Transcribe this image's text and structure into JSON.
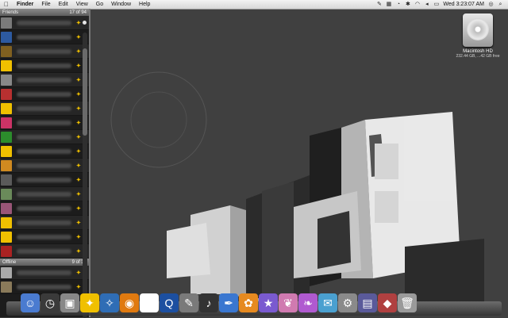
{
  "menubar": {
    "apple": "",
    "menus": [
      "Finder",
      "File",
      "Edit",
      "View",
      "Go",
      "Window",
      "Help"
    ],
    "clock": "Wed 3:23:07 AM",
    "icons": [
      "battery-icon",
      "volume-icon",
      "wifi-icon",
      "bluetooth-icon",
      "spotlight-icon"
    ]
  },
  "buddy_list": {
    "group1": {
      "name": "Friends",
      "count": "17 of 94"
    },
    "group2": {
      "name": "Offline",
      "count": "9 of 36"
    },
    "buddies1": [
      {
        "color": "#7a7a7a",
        "status": "#e6e6e6"
      },
      {
        "color": "#2d5aa0",
        "status": "#e6e6e6"
      },
      {
        "color": "#806020",
        "status": "#a8d84c"
      },
      {
        "color": "#f0c000",
        "status": "#e6e6e6"
      },
      {
        "color": "#888888",
        "status": "#e6e6e6"
      },
      {
        "color": "#b83030",
        "status": "#e6e6e6"
      },
      {
        "color": "#f0c000",
        "status": "#e6e6e6"
      },
      {
        "color": "#cc3366",
        "status": "#e6e6e6"
      },
      {
        "color": "#2c8c2c",
        "status": "#f0c000"
      },
      {
        "color": "#f0c000",
        "status": "#e04444"
      },
      {
        "color": "#d08a20",
        "status": "#e04444"
      },
      {
        "color": "#5a5a5a",
        "status": "#e04444"
      },
      {
        "color": "#6a8a5a",
        "status": "#e04444"
      },
      {
        "color": "#995577",
        "status": "#e04444"
      },
      {
        "color": "#f0c000",
        "status": "#e04444"
      },
      {
        "color": "#f0c000",
        "status": "#e04444"
      },
      {
        "color": "#aa2222",
        "status": "#e04444"
      }
    ],
    "buddies2": [
      {
        "color": "#aaaaaa",
        "status": "#e6e6e6"
      },
      {
        "color": "#8a7a5a",
        "status": "#e6e6e6"
      }
    ]
  },
  "drive": {
    "name": "Macintosh HD",
    "info": "232.44 GB, ...42 GB free"
  },
  "dock": [
    {
      "name": "finder-icon",
      "color": "#4a7bd0",
      "glyph": "☺"
    },
    {
      "name": "dashboard-icon",
      "color": "#3a3a3a",
      "glyph": "◷"
    },
    {
      "name": "preview-icon",
      "color": "#888",
      "glyph": "▣"
    },
    {
      "name": "aim-icon",
      "color": "#f0c000",
      "glyph": "✦"
    },
    {
      "name": "safari-icon",
      "color": "#2f6db5",
      "glyph": "✧"
    },
    {
      "name": "firefox-icon",
      "color": "#e07a10",
      "glyph": "◉"
    },
    {
      "name": "ical-icon",
      "color": "#ffffff",
      "glyph": "2"
    },
    {
      "name": "quicktime-icon",
      "color": "#1c4fa0",
      "glyph": "Q"
    },
    {
      "name": "photo-booth-icon",
      "color": "#7a7a7a",
      "glyph": "✎"
    },
    {
      "name": "itunes-icon",
      "color": "#333",
      "glyph": "♪"
    },
    {
      "name": "feather-icon",
      "color": "#3a77d0",
      "glyph": "✒"
    },
    {
      "name": "flower-icon",
      "color": "#e68a20",
      "glyph": "✿"
    },
    {
      "name": "star-icon",
      "color": "#7a5ad0",
      "glyph": "★"
    },
    {
      "name": "butterfly-icon",
      "color": "#d07ab0",
      "glyph": "❦"
    },
    {
      "name": "butterfly2-icon",
      "color": "#b05ad0",
      "glyph": "❧"
    },
    {
      "name": "mail-icon",
      "color": "#4aa0d0",
      "glyph": "✉"
    },
    {
      "name": "system-preferences-icon",
      "color": "#8a8a8a",
      "glyph": "⚙"
    },
    {
      "name": "documents-stack-icon",
      "color": "#5a5a9a",
      "glyph": "▤"
    },
    {
      "name": "applications-stack-icon",
      "color": "#b04040",
      "glyph": "◆"
    },
    {
      "name": "trash-icon",
      "color": "#9a9a9a",
      "glyph": "🗑"
    }
  ]
}
